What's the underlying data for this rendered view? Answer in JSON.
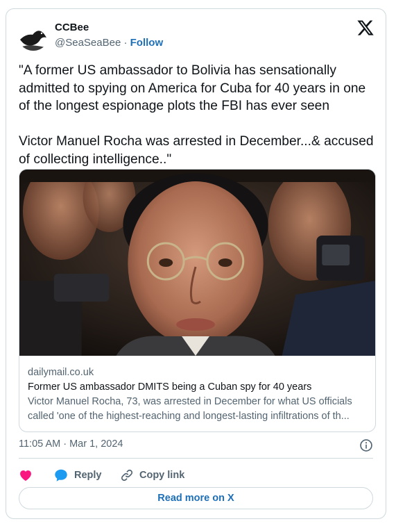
{
  "author": {
    "name": "CCBee",
    "handle": "@SeaSeaBee",
    "separator": "·",
    "follow_label": "Follow",
    "avatar_icon": "bird-silhouette-icon"
  },
  "platform_icon": "x-logo-icon",
  "tweet": {
    "text": "\"A former US ambassador to Bolivia has sensationally admitted to spying on America for Cuba for 40 years in one of the longest espionage plots the FBI has ever seen\n\nVictor Manuel Rocha was arrested in December...& accused of collecting intelligence..\""
  },
  "link_card": {
    "domain": "dailymail.co.uk",
    "title": "Former US ambassador DMITS being a Cuban spy for 40 years",
    "description": "Victor Manuel Rocha, 73, was arrested in December for what US officials called 'one of the highest-reaching and longest-lasting infiltrations of th..."
  },
  "timestamp": "11:05 AM · Mar 1, 2024",
  "actions": {
    "like_icon": "heart-icon",
    "reply_label": "Reply",
    "copy_label": "Copy link"
  },
  "read_more_label": "Read more on X",
  "colors": {
    "accent": "#1d6fb8",
    "like": "#f91880",
    "reply_bubble": "#1d9bf0",
    "border": "#cfd9de",
    "muted_text": "#536471"
  }
}
